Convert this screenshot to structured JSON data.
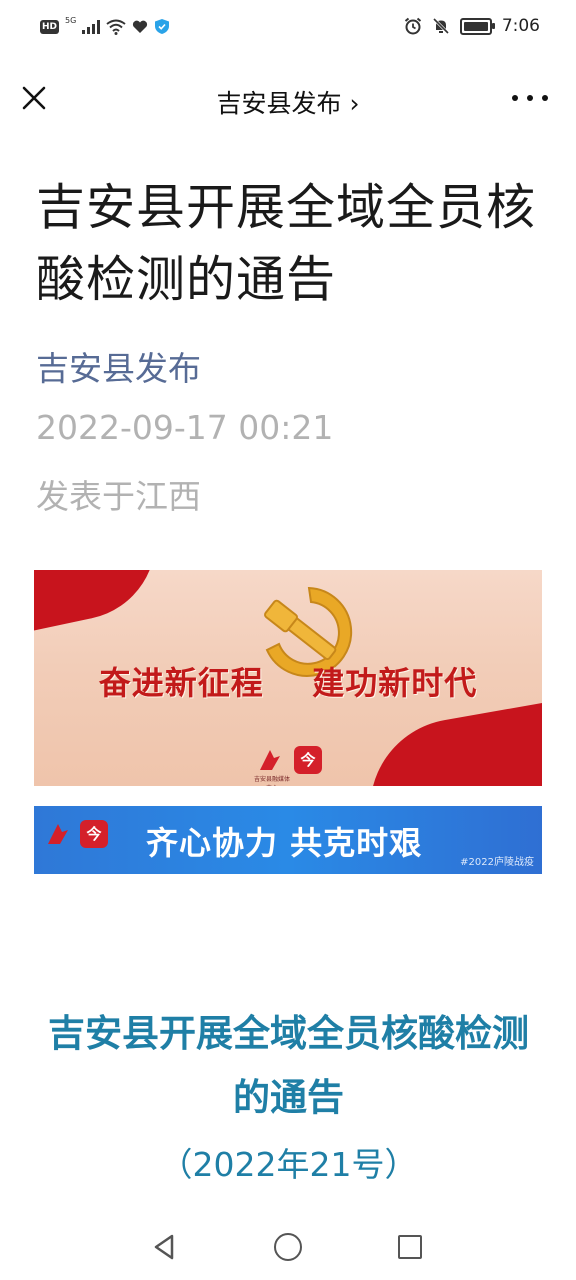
{
  "status_bar": {
    "hd": "HD",
    "network": "5G",
    "time": "7:06",
    "battery_level": 0.85,
    "icons_left": [
      "hd-icon",
      "signal-icon",
      "wifi-icon",
      "heart-icon",
      "shield-icon"
    ],
    "icons_right": [
      "alarm-icon",
      "mute-icon",
      "battery-icon"
    ]
  },
  "navbar": {
    "title": "吉安县发布 ›",
    "icons": [
      "close-icon",
      "more-icon"
    ]
  },
  "article": {
    "title": "吉安县开展全域全员核酸检测的通告",
    "account": "吉安县发布",
    "datetime": "2022-09-17 00:21",
    "location": "发表于江西"
  },
  "banner1": {
    "slogan": "奋进新征程    建功新时代",
    "logo_text": "吉安县融媒体中心",
    "logo_app": "今",
    "colors": {
      "red": "#c8141d",
      "gold": "#e9a826"
    }
  },
  "banner2": {
    "slogan": "齐心协力 共克时艰",
    "logo_app": "今",
    "tag": "#2022庐陵战疫",
    "colors": {
      "blue": "#2a8ae6"
    }
  },
  "notice": {
    "title": "吉安县开展全域全员核酸检测的通告",
    "number": "（2022年21号）",
    "color": "#1f7fa6"
  },
  "system_nav": {
    "icons": [
      "back-icon",
      "home-icon",
      "recent-apps-icon"
    ]
  }
}
